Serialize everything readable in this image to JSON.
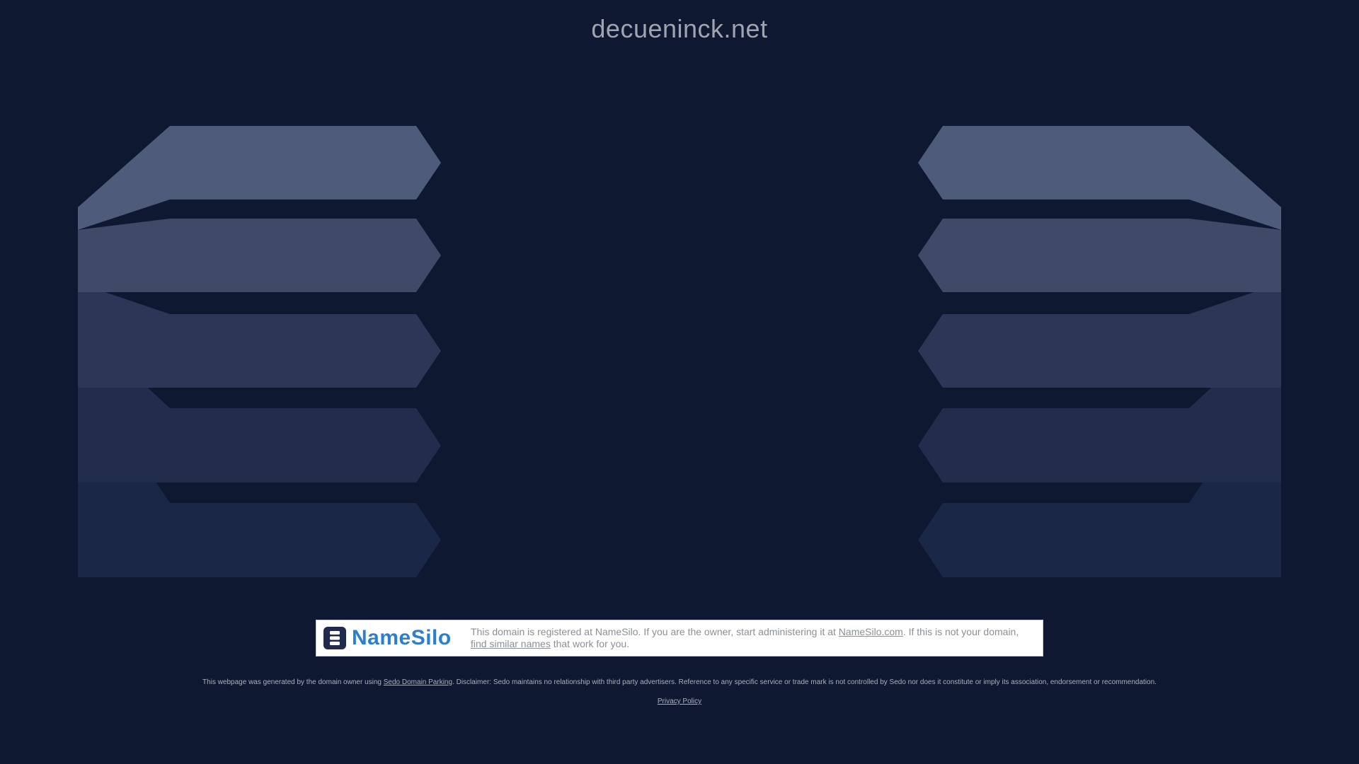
{
  "page": {
    "domain": "decueninck.net",
    "background_color": "#0e1830"
  },
  "banner": {
    "logo_name": "NameSilo",
    "logo_icon": "server-stack-icon",
    "text_before_link": "This domain is registered at NameSilo. If you are the owner, start administering it at ",
    "owner_link": "NameSilo.com",
    "text_middle": ". If this is not your domain, ",
    "similar_link": "find similar names",
    "text_after": " that work for you."
  },
  "footer": {
    "text_before_link": "This webpage was generated by the domain owner using ",
    "parking_link": "Sedo Domain Parking",
    "text_after_link": ". Disclaimer: Sedo maintains no relationship with third party advertisers. Reference to any specific service or trade mark is not controlled by Sedo nor does it constitute or imply its association, endorsement or recommendation.",
    "privacy_link": "Privacy Policy"
  },
  "colors": {
    "shape_top": "#4f5b7a",
    "shape_2": "#3f4a68",
    "shape_3": "#2c3656",
    "shape_4": "#222d4d",
    "shape_5": "#1a2746"
  }
}
